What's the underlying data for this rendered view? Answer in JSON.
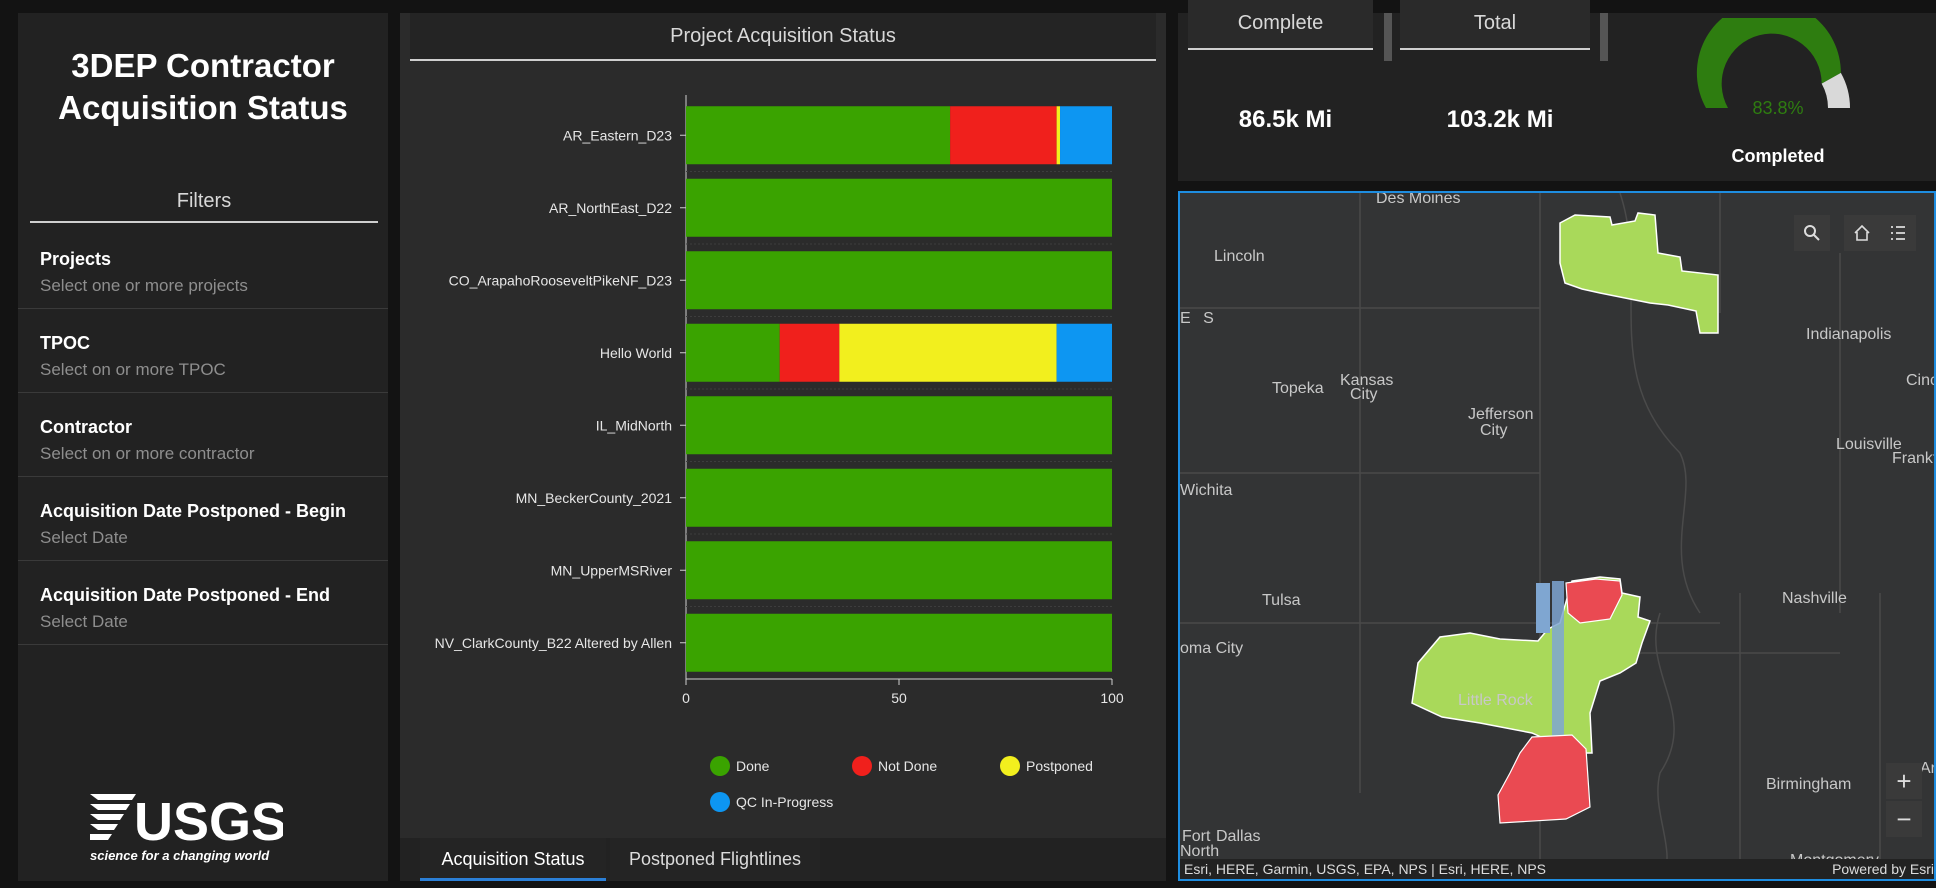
{
  "left_panel": {
    "title_line1": "3DEP Contractor",
    "title_line2": "Acquisition Status",
    "filters_heading": "Filters",
    "filters": [
      {
        "label": "Projects",
        "placeholder": "Select one or more projects"
      },
      {
        "label": "TPOC",
        "placeholder": "Select on or more TPOC"
      },
      {
        "label": "Contractor",
        "placeholder": "Select on or more contractor"
      },
      {
        "label": "Acquisition Date Postponed - Begin",
        "placeholder": "Select Date"
      },
      {
        "label": "Acquisition Date Postponed - End",
        "placeholder": "Select Date"
      }
    ],
    "logo_text": "USGS",
    "logo_tagline": "science for a changing world"
  },
  "chart_panel": {
    "title": "Project Acquisition Status",
    "tabs": [
      "Acquisition Status",
      "Postponed Flightlines"
    ]
  },
  "chart_data": {
    "type": "bar",
    "orientation": "horizontal",
    "stacked": true,
    "title": "Project Acquisition Status",
    "categories": [
      "AR_Eastern_D23",
      "AR_NorthEast_D22",
      "CO_ArapahoRooseveltPikeNF_D23",
      "Hello World",
      "IL_MidNorth",
      "MN_BeckerCounty_2021",
      "MN_UpperMSRiver",
      "NV_ClarkCounty_B22 Altered by Allen"
    ],
    "series": [
      {
        "name": "Done",
        "color": "#3aa300",
        "values": [
          62,
          100,
          100,
          22,
          100,
          100,
          100,
          100
        ]
      },
      {
        "name": "Not Done",
        "color": "#f0201c",
        "values": [
          25,
          0,
          0,
          14,
          0,
          0,
          0,
          0
        ]
      },
      {
        "name": "Postponed",
        "color": "#f2ef1e",
        "values": [
          0.8,
          0,
          0,
          51,
          0,
          0,
          0,
          0
        ]
      },
      {
        "name": "QC In-Progress",
        "color": "#0d96f2",
        "values": [
          12.2,
          0,
          0,
          13,
          0,
          0,
          0,
          0
        ]
      }
    ],
    "xlim": [
      0,
      100
    ],
    "xticks": [
      "0",
      "50",
      "100"
    ],
    "legend_position": "bottom"
  },
  "stats": {
    "complete_label": "Complete",
    "complete_value": "86.5k Mi",
    "total_label": "Total",
    "total_value": "103.2k Mi",
    "gauge_value_text": "83.8%",
    "gauge_fraction": 0.838,
    "gauge_label": "Completed"
  },
  "map": {
    "cities": [
      "Des Moines",
      "Lincoln",
      "E S",
      "Topeka",
      "Kansas",
      "City",
      "Jefferson",
      "City",
      "Indianapolis",
      "Cinc",
      "Louisville",
      "Frankf",
      "Wichita",
      "Tulsa",
      "oma City",
      "Nashville",
      "Little Rock",
      "Birmingham",
      "Ar",
      "Fort",
      "Dallas",
      "North",
      "Montgomery"
    ],
    "attribution": "Esri, HERE, Garmin, USGS, EPA, NPS | Esri, HERE, NPS",
    "powered_by": "Powered by Esri",
    "zoom_in": "+",
    "zoom_out": "−"
  }
}
